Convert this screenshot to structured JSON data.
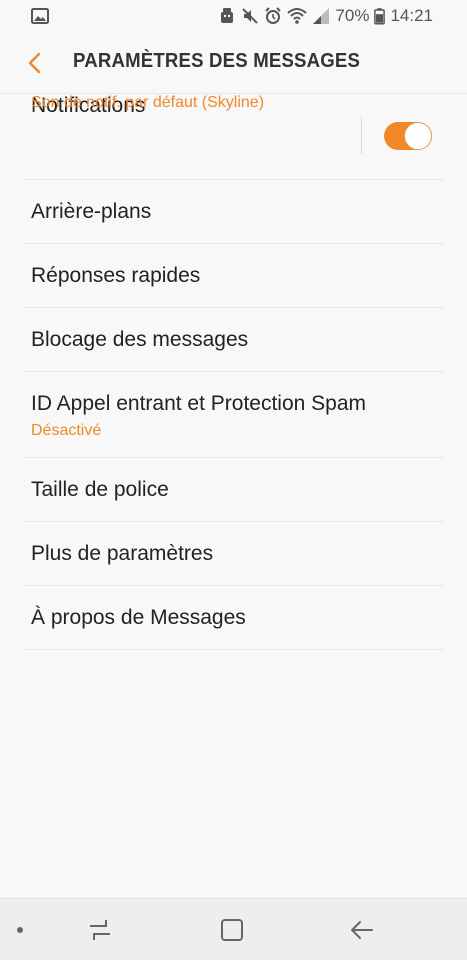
{
  "status_bar": {
    "battery_percent": "70%",
    "time": "14:21"
  },
  "header": {
    "title": "PARAMÈTRES DES MESSAGES",
    "back_icon": "chevron-left-icon"
  },
  "colors": {
    "accent": "#f0882a",
    "background": "#f8f8f8",
    "text_primary": "#222222",
    "nav_bar": "#eeeeee"
  },
  "settings": {
    "notifications": {
      "label": "Notifications",
      "subtitle": "Son de notif. par défaut (Skyline)",
      "enabled": true
    },
    "items": [
      {
        "label": "Arrière-plans"
      },
      {
        "label": "Réponses rapides"
      },
      {
        "label": "Blocage des messages"
      },
      {
        "label": "ID Appel entrant et Protection Spam",
        "subtitle": "Désactivé"
      },
      {
        "label": "Taille de police"
      },
      {
        "label": "Plus de paramètres"
      },
      {
        "label": "À propos de Messages"
      }
    ]
  }
}
